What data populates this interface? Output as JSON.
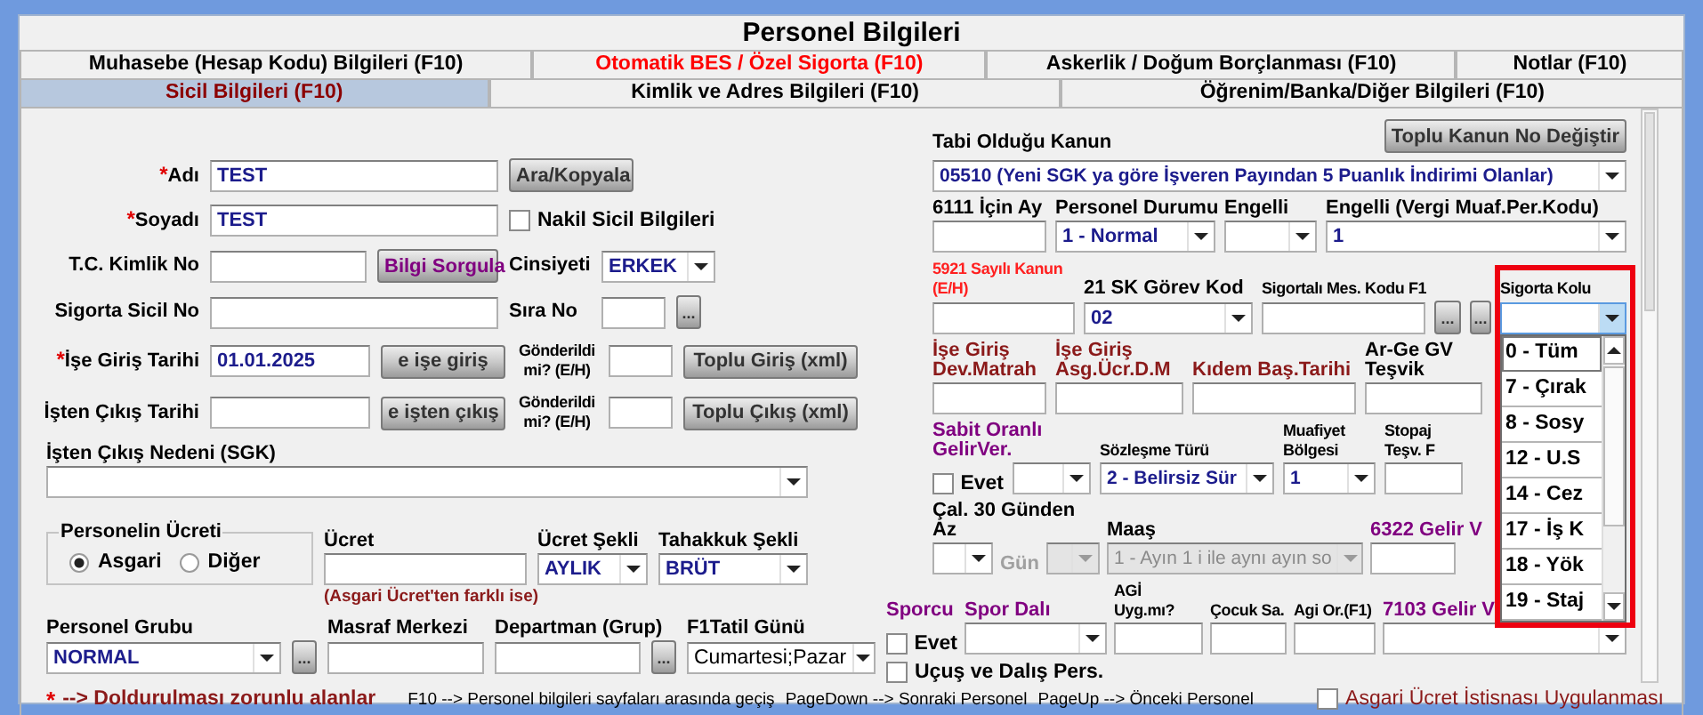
{
  "window": {
    "title": "Personel Bilgileri"
  },
  "tabs_top": [
    {
      "label": "Muhasebe (Hesap Kodu) Bilgileri (F10)",
      "selected": false,
      "color": "#000000"
    },
    {
      "label": "Otomatik BES / Özel Sigorta (F10)",
      "selected": false,
      "color": "#ff0000"
    },
    {
      "label": "Askerlik / Doğum Borçlanması (F10)",
      "selected": false,
      "color": "#000000"
    },
    {
      "label": "Notlar (F10)",
      "selected": false,
      "color": "#000000"
    }
  ],
  "tabs_bottom": [
    {
      "label": "Sicil Bilgileri (F10)",
      "selected": true
    },
    {
      "label": "Kimlik ve Adres Bilgileri (F10)",
      "selected": false
    },
    {
      "label": "Öğrenim/Banka/Diğer Bilgileri (F10)",
      "selected": false
    }
  ],
  "left_blocks": [
    [
      {
        "kind": "label",
        "mark": "*",
        "text": "Adı",
        "color": "#000000"
      },
      {
        "kind": "input",
        "value": "TEST"
      },
      {
        "kind": "button",
        "label": "Ara/Kopyala",
        "color": "#333333"
      }
    ],
    [
      {
        "kind": "label",
        "mark": "*",
        "text": "Soyadı",
        "color": "#000000"
      },
      {
        "kind": "input",
        "value": "TEST"
      },
      {
        "kind": "check",
        "label": "Nakil Sicil Bilgileri",
        "checked": false
      }
    ],
    [
      {
        "kind": "label",
        "text": "T.C. Kimlik No",
        "color": "#000000"
      },
      {
        "kind": "input"
      },
      {
        "kind": "button",
        "label": "Bilgi Sorgula",
        "color": "#800080"
      },
      {
        "kind": "label",
        "text": "Cinsiyeti",
        "color": "#000000"
      },
      {
        "kind": "select",
        "value": "ERKEK",
        "disabled": false
      }
    ],
    [
      {
        "kind": "label",
        "text": "Sigorta Sicil No",
        "color": "#000000"
      },
      {
        "kind": "input"
      },
      {
        "kind": "label",
        "text": "Sıra No",
        "color": "#000000"
      },
      {
        "kind": "input"
      },
      {
        "kind": "button",
        "label": "...",
        "color": "#333333"
      }
    ],
    [
      {
        "kind": "label",
        "mark": "*",
        "text": "İşe Giriş Tarihi",
        "color": "#000000"
      },
      {
        "kind": "input",
        "value": "01.01.2025"
      },
      {
        "kind": "button",
        "label": "e işe giriş",
        "color": "#333333"
      },
      {
        "kind": "caption",
        "text": "Gönderildi mi? (E/H)",
        "color": "#000000"
      },
      {
        "kind": "input"
      },
      {
        "kind": "button",
        "label": "Toplu Giriş (xml)",
        "color": "#333333"
      }
    ],
    [
      {
        "kind": "label",
        "text": "İşten Çıkış Tarihi",
        "color": "#000000"
      },
      {
        "kind": "input"
      },
      {
        "kind": "button",
        "label": "e işten çıkış",
        "color": "#333333"
      },
      {
        "kind": "caption",
        "text": "Gönderildi mi? (E/H)",
        "color": "#000000"
      },
      {
        "kind": "input"
      },
      {
        "kind": "button",
        "label": "Toplu Çıkış (xml)",
        "color": "#333333"
      }
    ],
    [
      {
        "kind": "label",
        "text": "İşten Çıkış Nedeni (SGK)",
        "color": "#000000"
      },
      {
        "kind": "select",
        "disabled": false
      }
    ],
    [
      {
        "kind": "radios",
        "title": "Personelin Ücreti",
        "options": [
          {
            "label": "Asgari",
            "selected": true
          },
          {
            "label": "Diğer",
            "selected": false
          }
        ]
      },
      {
        "kind": "label",
        "text": "Ücret",
        "color": "#000000"
      },
      {
        "kind": "label",
        "text": "Ücret Şekli",
        "color": "#000000"
      },
      {
        "kind": "label",
        "text": "Tahakkuk Şekli",
        "color": "#000000"
      },
      {
        "kind": "input"
      },
      {
        "kind": "select",
        "value": "AYLIK",
        "disabled": false
      },
      {
        "kind": "select",
        "value": "BRÜT",
        "disabled": false
      },
      {
        "kind": "note",
        "text": "(Asgari Ücret'ten farklı ise)",
        "color": "#8b1a1a"
      }
    ],
    [
      {
        "kind": "label",
        "text": "Personel Grubu",
        "color": "#000000"
      },
      {
        "kind": "label",
        "text": "Masraf Merkezi",
        "color": "#000000"
      },
      {
        "kind": "label",
        "text": "Departman (Grup)",
        "color": "#000000"
      },
      {
        "kind": "label",
        "text": "F1Tatil Günü",
        "color": "#000000"
      },
      {
        "kind": "select",
        "value": "NORMAL",
        "disabled": false
      },
      {
        "kind": "button",
        "label": "...",
        "color": "#333333"
      },
      {
        "kind": "input"
      },
      {
        "kind": "input"
      },
      {
        "kind": "button",
        "label": "...",
        "color": "#333333"
      },
      {
        "kind": "select",
        "value": "Cumartesi;Pazar",
        "disabled": false
      }
    ]
  ],
  "right_blocks": [
    [
      {
        "kind": "label",
        "text": "Tabi Olduğu Kanun",
        "color": "#000000"
      },
      {
        "kind": "button",
        "label": "Toplu Kanun No Değiştir",
        "color": "#333333"
      }
    ],
    [
      {
        "kind": "select",
        "value": "05510 (Yeni SGK ya göre İşveren Payından 5 Puanlık İndirimi Olanlar)",
        "disabled": false
      }
    ],
    [
      {
        "kind": "label",
        "text": "6111 İçin Ay",
        "color": "#000000"
      },
      {
        "kind": "label",
        "text": "Personel Durumu",
        "color": "#000000"
      },
      {
        "kind": "label",
        "text": "Engelli",
        "color": "#000000"
      },
      {
        "kind": "label",
        "text": "Engelli (Vergi Muaf.Per.Kodu)",
        "color": "#000000"
      },
      {
        "kind": "input"
      },
      {
        "kind": "select",
        "value": "1 - Normal",
        "disabled": false
      },
      {
        "kind": "select",
        "disabled": false
      },
      {
        "kind": "select",
        "value": "1",
        "disabled": false
      }
    ],
    [
      {
        "kind": "caption",
        "text": "5921 Sayılı Kanun (E/H)",
        "color": "#ff2020"
      },
      {
        "kind": "label",
        "text": "21 SK Görev Kod",
        "color": "#000000"
      },
      {
        "kind": "caption",
        "text": "Sigortalı Mes. Kodu F1",
        "color": "#000000"
      },
      {
        "kind": "caption",
        "text": "Sigorta Kolu",
        "color": "#000000"
      },
      {
        "kind": "input"
      },
      {
        "kind": "select",
        "value": "02",
        "disabled": false
      },
      {
        "kind": "input"
      },
      {
        "kind": "button",
        "label": "...",
        "color": "#333333"
      },
      {
        "kind": "button",
        "label": "...",
        "color": "#333333"
      },
      {
        "kind": "combo",
        "open": true,
        "outlined": true,
        "options": [
          {
            "label": "0 - Tüm",
            "selected": true
          },
          {
            "label": "7 - Çırak",
            "selected": false
          },
          {
            "label": "8 - Sosy",
            "selected": false
          },
          {
            "label": "12 - U.S",
            "selected": false
          },
          {
            "label": "14 - Cez",
            "selected": false
          },
          {
            "label": "17 - İş K",
            "selected": false
          },
          {
            "label": "18 - Yök",
            "selected": false
          },
          {
            "label": "19 - Staj",
            "selected": false
          }
        ]
      }
    ],
    [
      {
        "kind": "label",
        "text": "İşe Giriş\nDev.Matrah",
        "color": "#8b1a1a"
      },
      {
        "kind": "label",
        "text": "İşe Giriş\nAsg.Ücr.D.M",
        "color": "#8b1a1a"
      },
      {
        "kind": "label",
        "text": "Kıdem Baş.Tarihi",
        "color": "#8b1a1a"
      },
      {
        "kind": "label",
        "text": "Ar-Ge GV Teşvik",
        "color": "#000000"
      },
      {
        "kind": "input"
      },
      {
        "kind": "input"
      },
      {
        "kind": "input"
      },
      {
        "kind": "input"
      }
    ],
    [
      {
        "kind": "label",
        "text": "Sabit Oranlı GelirVer.",
        "color": "#800080"
      },
      {
        "kind": "caption",
        "text": "Sözleşme Türü",
        "color": "#000000"
      },
      {
        "kind": "caption",
        "text": "Muafiyet Bölgesi",
        "color": "#000000"
      },
      {
        "kind": "caption",
        "text": "Stopaj Teşv. F",
        "color": "#000000"
      },
      {
        "kind": "check",
        "label": "Evet",
        "checked": false
      },
      {
        "kind": "select",
        "disabled": false
      },
      {
        "kind": "select",
        "value": "2 - Belirsiz Sür",
        "disabled": false
      },
      {
        "kind": "select",
        "value": "1",
        "disabled": false
      },
      {
        "kind": "input"
      }
    ],
    [
      {
        "kind": "label",
        "text": "Çal. 30 Günden Az",
        "color": "#000000"
      },
      {
        "kind": "label",
        "text": "Maaş",
        "color": "#000000"
      },
      {
        "kind": "label",
        "text": "6322 Gelir V",
        "color": "#800080"
      },
      {
        "kind": "select",
        "disabled": false
      },
      {
        "kind": "label",
        "text": "Gün",
        "color": "#a0a0a0"
      },
      {
        "kind": "select",
        "disabled": true
      },
      {
        "kind": "select",
        "value": "1 - Ayın 1 i ile aynı ayın so",
        "disabled": true
      },
      {
        "kind": "input"
      }
    ],
    [
      {
        "kind": "label",
        "text": "Sporcu",
        "color": "#800080"
      },
      {
        "kind": "label",
        "text": "Spor Dalı",
        "color": "#800080"
      },
      {
        "kind": "caption",
        "text": "AGİ Uyg.mı?",
        "color": "#000000"
      },
      {
        "kind": "caption",
        "text": "Çocuk Sa.",
        "color": "#000000"
      },
      {
        "kind": "caption",
        "text": "Agi Or.(F1)",
        "color": "#000000"
      },
      {
        "kind": "label",
        "text": "7103 Gelir V",
        "color": "#800080"
      },
      {
        "kind": "check",
        "label": "Evet",
        "checked": false
      },
      {
        "kind": "select",
        "disabled": false
      },
      {
        "kind": "input"
      },
      {
        "kind": "input"
      },
      {
        "kind": "input"
      },
      {
        "kind": "select",
        "disabled": false
      }
    ],
    [
      {
        "kind": "check",
        "label": "Uçuş ve Dalış Pers.",
        "checked": false
      }
    ]
  ],
  "footer": {
    "mark": "*",
    "legend": "--> Doldurulması zorunlu alanlar",
    "help": [
      "F10 --> Personel bilgileri sayfaları arasında geçiş",
      "PageDown --> Sonraki Personel",
      "PageUp --> Önceki Personel"
    ],
    "option": {
      "label": "Asgari Ücret İstisnası Uygulanması",
      "checked": false
    }
  }
}
